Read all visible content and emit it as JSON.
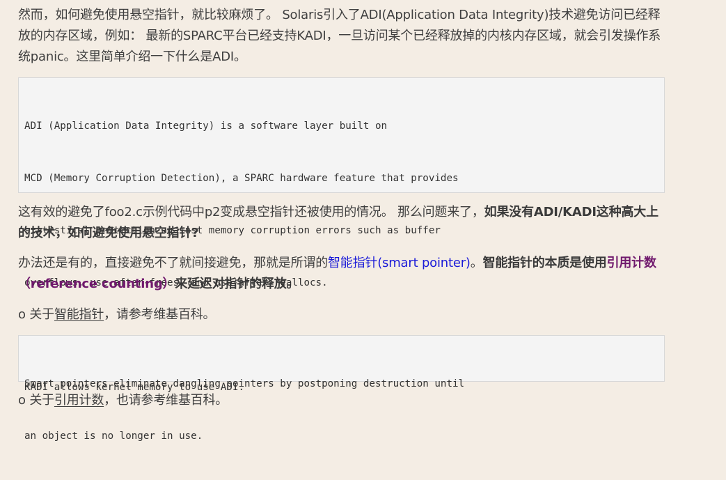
{
  "paragraph1": "然而，如何避免使用悬空指针，就比较麻烦了。 Solaris引入了ADI(Application Data Integrity)技术避免访问已经释放的内存区域，例如： 最新的SPARC平台已经支持KADI，一旦访问某个已经释放掉的内核内存区域，就会引发操作系统panic。这里简单介绍一下什么是ADI。",
  "code_block1": {
    "lines": [
      "ADI (Application Data Integrity) is a software layer built on",
      "MCD (Memory Corruption Detection), a SPARC hardware feature that provides",
      "statistical protection against memory corruption errors such as buffer",
      "overflows, use-after-frees, and use-after-reallocs.",
      "",
      "KADI allows kernel memory to use ADI."
    ]
  },
  "paragraph2": {
    "normal": "这有效的避免了foo2.c示例代码中p2变成悬空指针还被使用的情况。 那么问题来了，",
    "bold": "如果没有ADI/KADI这种高大上的技术，如何避免使用悬空指针?"
  },
  "paragraph3": {
    "text1": "办法还是有的，直接避免不了就间接避免，那就是所谓的",
    "link": "智能指针(smart pointer)",
    "text2": "。",
    "bold1": "智能指针的本质是使用",
    "purple": "引用计数（reference counting）",
    "bold2": "来延迟对指针的释放。"
  },
  "bullet1": {
    "prefix": "o 关于",
    "link": "智能指针",
    "suffix": "，请参考维基百科。"
  },
  "code_block2": {
    "lines": [
      "Smart pointers eliminate dangling pointers by postponing destruction until",
      "an object is no longer in use."
    ]
  },
  "bullet2": {
    "prefix": "o 关于",
    "link": "引用计数",
    "suffix": "，也请参考维基百科。"
  }
}
